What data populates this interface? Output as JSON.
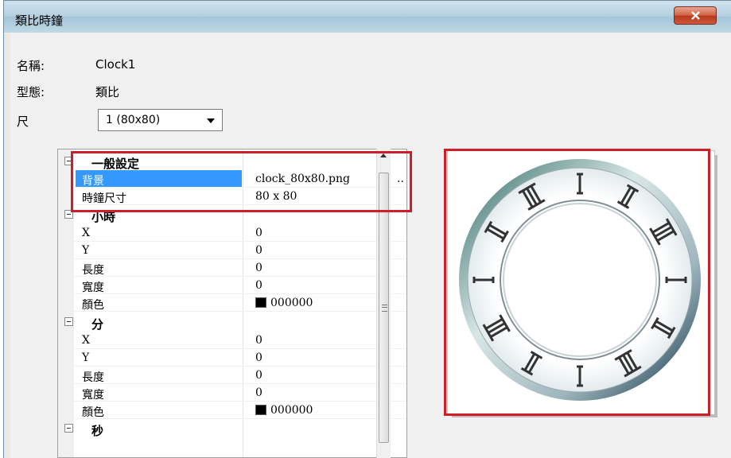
{
  "window": {
    "title": "類比時鐘",
    "close_symbol": "X"
  },
  "fields": {
    "name_label": "名稱:",
    "name_value": "Clock1",
    "type_label": "型態:",
    "type_value": "類比",
    "size_label": "尺",
    "size_selected": "1  (80x80)"
  },
  "grid": {
    "general": {
      "category": "一般設定",
      "background_name": "背景",
      "background_value": "clock_80x80.png",
      "background_button": "..",
      "clock_size_name": "時鐘尺寸",
      "clock_size_value": "80 x 80"
    },
    "hour": {
      "category": "小時",
      "x_name": "X",
      "x_value": "0",
      "y_name": "Y",
      "y_value": "0",
      "length_name": "長度",
      "length_value": "0",
      "width_name": "寬度",
      "width_value": "0",
      "color_name": "顏色",
      "color_value": "000000"
    },
    "minute": {
      "category": "分",
      "x_name": "X",
      "x_value": "0",
      "y_name": "Y",
      "y_value": "0",
      "length_name": "長度",
      "length_value": "0",
      "width_name": "寬度",
      "width_value": "0",
      "color_name": "顏色",
      "color_value": "000000"
    },
    "second": {
      "category": "秒"
    }
  },
  "colors": {
    "highlight": "#cc1f2b",
    "selection": "#3399ff",
    "swatch": "#000000"
  },
  "preview": {
    "image_name": "clock_80x80.png",
    "icon": "analog-clock-face-icon"
  }
}
